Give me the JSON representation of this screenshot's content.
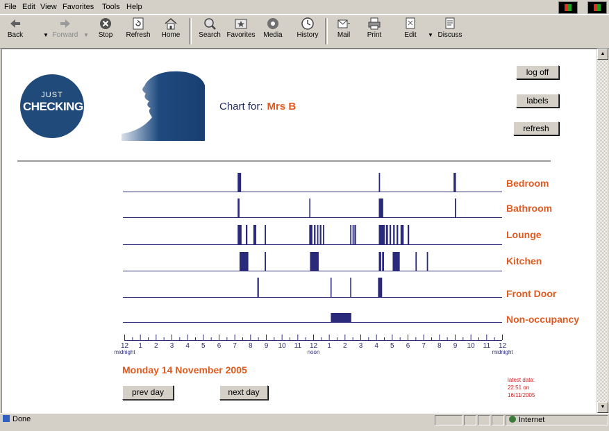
{
  "menu": [
    "File",
    "Edit",
    "View",
    "Favorites",
    "Tools",
    "Help"
  ],
  "toolbar": {
    "back": "Back",
    "forward": "Forward",
    "stop": "Stop",
    "refresh": "Refresh",
    "home": "Home",
    "search": "Search",
    "favorites": "Favorites",
    "media": "Media",
    "history": "History",
    "mail": "Mail",
    "print": "Print",
    "edit": "Edit",
    "discuss": "Discuss"
  },
  "page": {
    "logo_line1": "JUST",
    "logo_line2": "CHECKING",
    "chart_for_label": "Chart for:",
    "person": "Mrs B",
    "log_off": "log off",
    "labels": "labels",
    "refresh": "refresh",
    "date": "Monday 14 November 2005",
    "prev_day": "prev day",
    "next_day": "next day",
    "latest_line1": "latest data:",
    "latest_line2": "22:51 on",
    "latest_line3": "16/11/2005"
  },
  "colors": {
    "bars": "#2b2a7a",
    "labels": "#e05a20",
    "axis": "#2b2a7a"
  },
  "chart_data": {
    "type": "timeline",
    "x_range_hours": [
      0,
      24
    ],
    "tick_labels": [
      "12",
      "1",
      "2",
      "3",
      "4",
      "5",
      "6",
      "7",
      "8",
      "9",
      "10",
      "11",
      "12",
      "1",
      "2",
      "3",
      "4",
      "5",
      "6",
      "7",
      "8",
      "9",
      "10",
      "11",
      "12"
    ],
    "tick_sublabels": {
      "0": "midnight",
      "12": "noon",
      "24": "midnight"
    },
    "rows": [
      {
        "name": "Bedroom",
        "events": [
          [
            7.2,
            7.42
          ],
          [
            16.17,
            16.25
          ],
          [
            20.92,
            21.07
          ]
        ]
      },
      {
        "name": "Bathroom",
        "events": [
          [
            7.2,
            7.32
          ],
          [
            11.75,
            11.82
          ],
          [
            16.17,
            16.45
          ],
          [
            21.0,
            21.08
          ]
        ]
      },
      {
        "name": "Lounge",
        "events": [
          [
            7.2,
            7.45
          ],
          [
            7.72,
            7.82
          ],
          [
            8.2,
            8.38
          ],
          [
            8.92,
            9.0
          ],
          [
            11.75,
            11.95
          ],
          [
            12.05,
            12.15
          ],
          [
            12.25,
            12.33
          ],
          [
            12.42,
            12.52
          ],
          [
            12.62,
            12.7
          ],
          [
            14.35,
            14.43
          ],
          [
            14.5,
            14.58
          ],
          [
            14.62,
            14.72
          ],
          [
            16.17,
            16.55
          ],
          [
            16.62,
            16.75
          ],
          [
            16.85,
            16.95
          ],
          [
            17.08,
            17.18
          ],
          [
            17.3,
            17.4
          ],
          [
            17.55,
            17.75
          ],
          [
            18.0,
            18.1
          ]
        ]
      },
      {
        "name": "Kitchen",
        "events": [
          [
            7.32,
            7.88
          ],
          [
            8.92,
            9.0
          ],
          [
            11.8,
            12.35
          ],
          [
            16.17,
            16.32
          ],
          [
            16.38,
            16.5
          ],
          [
            17.05,
            17.5
          ],
          [
            18.5,
            18.58
          ],
          [
            19.22,
            19.3
          ]
        ]
      },
      {
        "name": "Front Door",
        "events": [
          [
            8.45,
            8.55
          ],
          [
            13.1,
            13.17
          ],
          [
            14.35,
            14.42
          ],
          [
            16.12,
            16.38
          ]
        ]
      },
      {
        "name": "Non-occupancy",
        "events": [
          [
            13.12,
            14.42
          ]
        ]
      }
    ]
  }
}
